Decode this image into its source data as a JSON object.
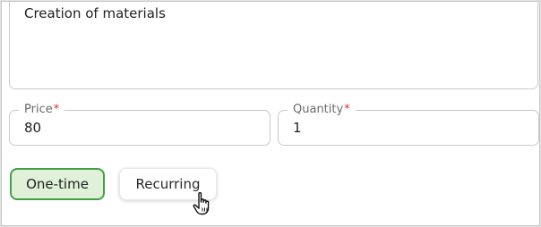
{
  "description": {
    "value": "Creation of materials"
  },
  "price": {
    "label": "Price",
    "required_mark": "*",
    "value": "80"
  },
  "quantity": {
    "label": "Quantity",
    "required_mark": "*",
    "value": "1"
  },
  "frequency": {
    "options": [
      "One-time",
      "Recurring"
    ],
    "selected": "One-time"
  },
  "colors": {
    "selected_fill": "#dff1d8",
    "selected_border": "#45a044",
    "required": "#d4322f"
  },
  "icons": {
    "cursor": "hand-pointer-icon"
  }
}
